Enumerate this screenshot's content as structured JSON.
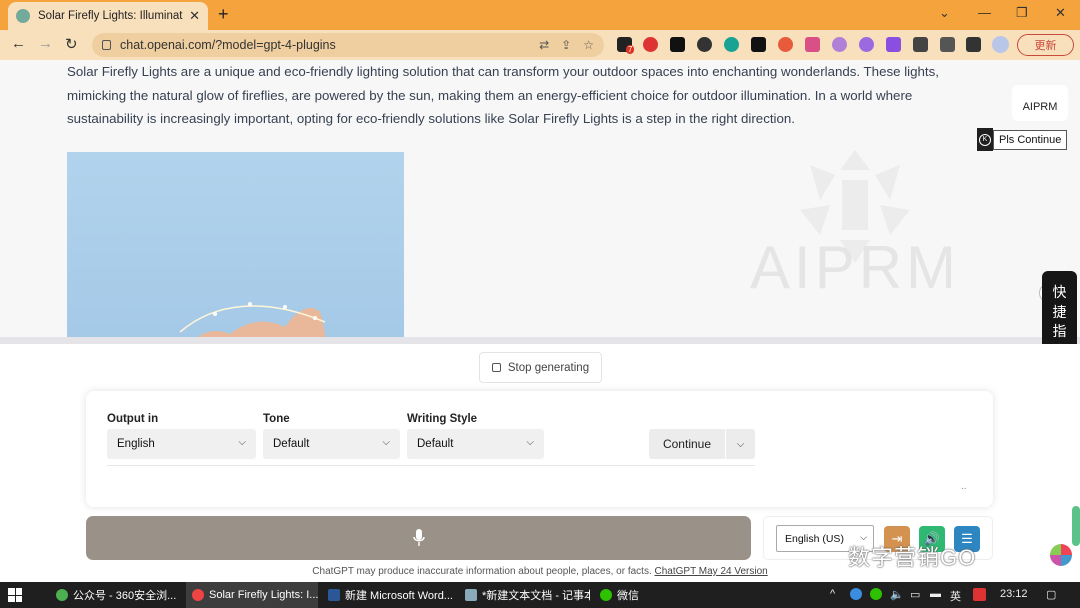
{
  "browser": {
    "tab_title": "Solar Firefly Lights: Illuminatin",
    "new_tab_symbol": "+",
    "url": "chat.openai.com/?model=gpt-4-plugins",
    "update_button": "更新",
    "extension_badge": "7"
  },
  "content": {
    "paragraph": "Solar Firefly Lights are a unique and eco-friendly lighting solution that can transform your outdoor spaces into enchanting wonderlands. These lights, mimicking the natural glow of fireflies, are powered by the sun, making them an energy-efficient choice for outdoor illumination. In a world where sustainability is increasingly important, opting for eco-friendly solutions like Solar Firefly Lights is a step in the right direction.",
    "watermark": "AIPRM",
    "aiprm_logo_label": "AIPRM",
    "tooltip_label": "Pls Continue",
    "tooltip_k": "K",
    "quick_command": [
      "快",
      "捷",
      "指",
      "令"
    ]
  },
  "composer": {
    "stop_label": "Stop generating",
    "output_label": "Output in",
    "output_value": "English",
    "tone_label": "Tone",
    "tone_value": "Default",
    "style_label": "Writing Style",
    "style_value": "Default",
    "continue_label": "Continue",
    "dots": "..",
    "voice_lang": "English (US)",
    "disclaimer": "ChatGPT may produce inaccurate information about people, places, or facts.",
    "disclaimer_link": "ChatGPT May 24 Version",
    "brand_text": "数字营销GO"
  },
  "taskbar": {
    "tasks": [
      "公众号 - 360安全浏...",
      "Solar Firefly Lights: I...",
      "新建 Microsoft Word...",
      "*新建文本文档 - 记事本",
      "微信"
    ],
    "ime": "英",
    "time": "23:12"
  },
  "colors": {
    "tabstrip": "#f5a33c",
    "toolbar": "#f8e0bd",
    "voice_bar": "#9a9188",
    "skip_button": "#d49250",
    "speaker_button": "#2eb872",
    "settings_button": "#2e86c1"
  }
}
